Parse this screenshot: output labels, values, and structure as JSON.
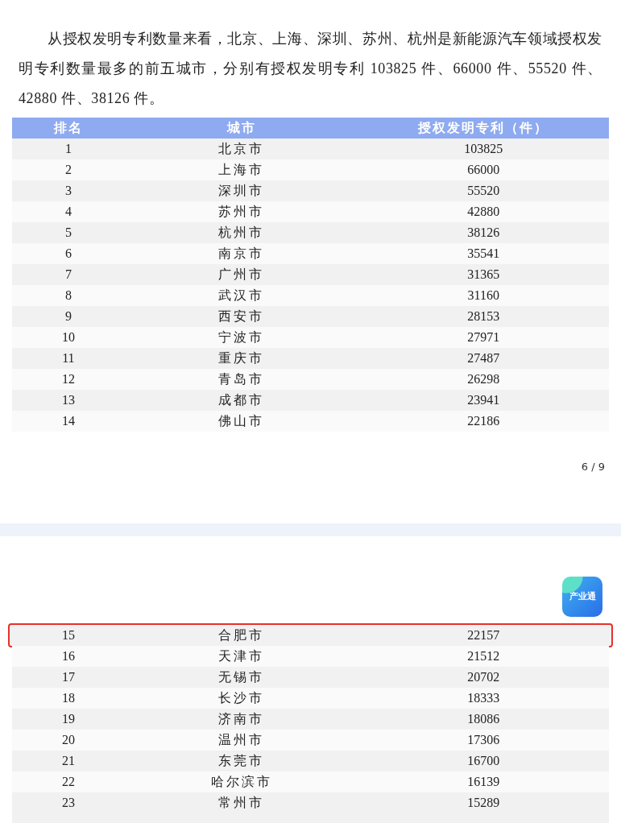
{
  "pages": [
    {
      "paragraph": "从授权发明专利数量来看，北京、上海、深圳、苏州、杭州是新能源汽车领域授权发明专利数量最多的前五城市，分别有授权发明专利 103825 件、66000 件、55520 件、42880 件、38126 件。",
      "table": {
        "columns": [
          "排名",
          "城市",
          "授权发明专利（件）"
        ],
        "rows": [
          {
            "cells": [
              "1",
              "北京市",
              "103825"
            ],
            "highlighted": false
          },
          {
            "cells": [
              "2",
              "上海市",
              "66000"
            ],
            "highlighted": false
          },
          {
            "cells": [
              "3",
              "深圳市",
              "55520"
            ],
            "highlighted": false
          },
          {
            "cells": [
              "4",
              "苏州市",
              "42880"
            ],
            "highlighted": false
          },
          {
            "cells": [
              "5",
              "杭州市",
              "38126"
            ],
            "highlighted": false
          },
          {
            "cells": [
              "6",
              "南京市",
              "35541"
            ],
            "highlighted": false
          },
          {
            "cells": [
              "7",
              "广州市",
              "31365"
            ],
            "highlighted": false
          },
          {
            "cells": [
              "8",
              "武汉市",
              "31160"
            ],
            "highlighted": false
          },
          {
            "cells": [
              "9",
              "西安市",
              "28153"
            ],
            "highlighted": false
          },
          {
            "cells": [
              "10",
              "宁波市",
              "27971"
            ],
            "highlighted": false
          },
          {
            "cells": [
              "11",
              "重庆市",
              "27487"
            ],
            "highlighted": false
          },
          {
            "cells": [
              "12",
              "青岛市",
              "26298"
            ],
            "highlighted": false
          },
          {
            "cells": [
              "13",
              "成都市",
              "23941"
            ],
            "highlighted": false
          },
          {
            "cells": [
              "14",
              "佛山市",
              "22186"
            ],
            "highlighted": false
          }
        ]
      },
      "page_number": "6 / 9"
    },
    {
      "app_logo": "产业通",
      "table": {
        "rows": [
          {
            "cells": [
              "15",
              "合肥市",
              "22157"
            ],
            "highlighted": true
          },
          {
            "cells": [
              "16",
              "天津市",
              "21512"
            ],
            "highlighted": false
          },
          {
            "cells": [
              "17",
              "无锡市",
              "20702"
            ],
            "highlighted": false
          },
          {
            "cells": [
              "18",
              "长沙市",
              "18333"
            ],
            "highlighted": false
          },
          {
            "cells": [
              "19",
              "济南市",
              "18086"
            ],
            "highlighted": false
          },
          {
            "cells": [
              "20",
              "温州市",
              "17306"
            ],
            "highlighted": false
          },
          {
            "cells": [
              "21",
              "东莞市",
              "16700"
            ],
            "highlighted": false
          },
          {
            "cells": [
              "22",
              "哈尔滨市",
              "16139"
            ],
            "highlighted": false
          },
          {
            "cells": [
              "23",
              "常州市",
              "15289"
            ],
            "highlighted": false
          }
        ]
      }
    }
  ]
}
